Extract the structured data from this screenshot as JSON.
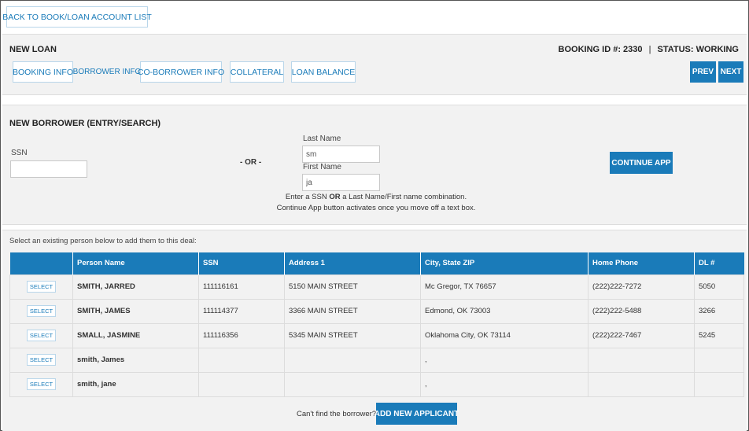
{
  "top_nav": {
    "back_label": "BACK TO BOOK/LOAN ACCOUNT LIST"
  },
  "header": {
    "title": "NEW LOAN",
    "booking_label": "BOOKING ID #:",
    "booking_id": "2330",
    "separator": "|",
    "status_label": "STATUS:",
    "status_value": "WORKING",
    "tabs": [
      {
        "label": "BOOKING INFO",
        "active": false
      },
      {
        "label": "BORROWER INFO",
        "active": true
      },
      {
        "label": "CO-BORROWER INFO",
        "active": false
      },
      {
        "label": "COLLATERAL",
        "active": false
      },
      {
        "label": "LOAN BALANCE",
        "active": false
      }
    ],
    "prev_label": "PREV",
    "next_label": "NEXT"
  },
  "entry": {
    "title": "NEW BORROWER (ENTRY/SEARCH)",
    "ssn_label": "SSN",
    "ssn_value": "",
    "or_label": "- OR -",
    "last_name_label": "Last Name",
    "last_name_value": "sm",
    "first_name_label": "First Name",
    "first_name_value": "ja",
    "hint_line1_pre": "Enter a SSN ",
    "hint_line1_bold": "OR",
    "hint_line1_post": " a Last Name/First name combination.",
    "hint_line2": "Continue App button activates once you move off a text box.",
    "continue_label": "CONTINUE APP"
  },
  "results": {
    "intro": "Select an existing person below to add them to this deal:",
    "columns": [
      "",
      "Person Name",
      "SSN",
      "Address 1",
      "City, State ZIP",
      "Home Phone",
      "DL #"
    ],
    "select_label": "SELECT",
    "rows": [
      {
        "name": "SMITH, JARRED",
        "ssn": "111116161",
        "address": "5150 MAIN STREET",
        "city": "Mc Gregor, TX 76657",
        "phone": "(222)222-7272",
        "dl": "5050"
      },
      {
        "name": "SMITH, JAMES",
        "ssn": "111114377",
        "address": "3366 MAIN STREET",
        "city": "Edmond, OK 73003",
        "phone": "(222)222-5488",
        "dl": "3266"
      },
      {
        "name": "SMALL, JASMINE",
        "ssn": "111116356",
        "address": "5345 MAIN STREET",
        "city": "Oklahoma City, OK 73114",
        "phone": "(222)222-7467",
        "dl": "5245"
      },
      {
        "name": "smith, James",
        "ssn": "",
        "address": "",
        "city": ",",
        "phone": "",
        "dl": ""
      },
      {
        "name": "smith, jane",
        "ssn": "",
        "address": "",
        "city": ",",
        "phone": "",
        "dl": ""
      }
    ]
  },
  "footer": {
    "cant_find": "Can't find the borrower?",
    "add_label": "ADD NEW APPLICANT"
  },
  "colors": {
    "accent": "#1a7bb9",
    "panel_bg": "#f2f2f2",
    "outline": "#b9d6ea"
  }
}
